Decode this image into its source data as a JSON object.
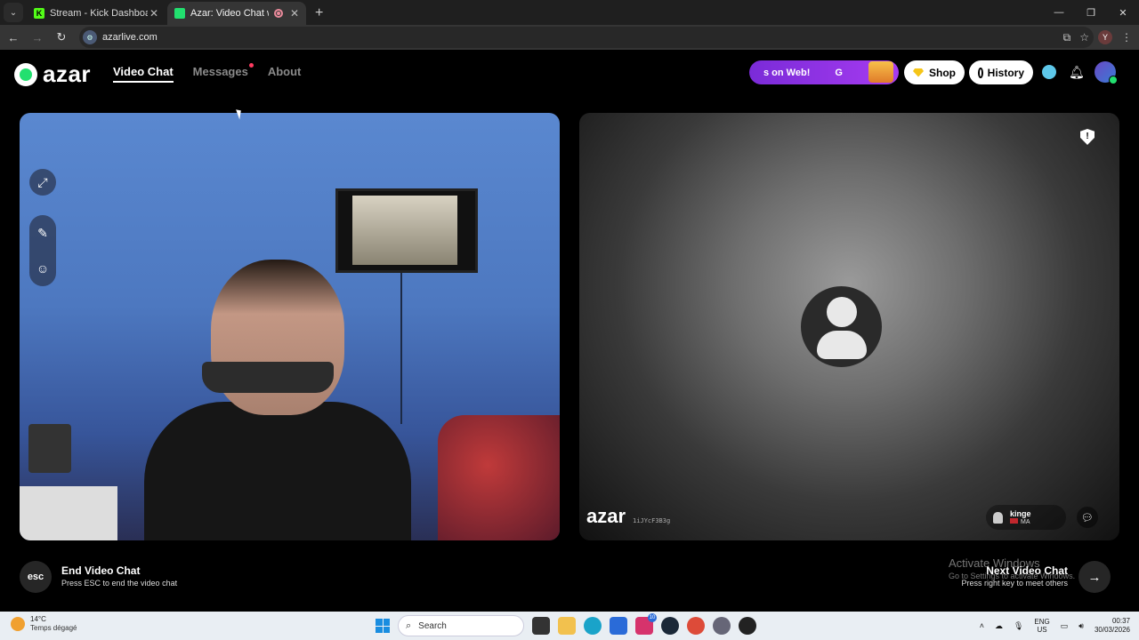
{
  "browser": {
    "tabs": [
      {
        "title": "Stream - Kick Dashboard",
        "favicon": "kick-icon",
        "color": "#53fc18",
        "active": false
      },
      {
        "title": "Azar: Video Chat with New",
        "favicon": "azar-icon",
        "color": "#22e06f",
        "active": true
      }
    ],
    "url": "azarlive.com",
    "profile_initial": "Y"
  },
  "nav": {
    "logo": "azar",
    "links": [
      {
        "label": "Video Chat",
        "active": true
      },
      {
        "label": "Messages",
        "active": false,
        "has_notification": true
      },
      {
        "label": "About",
        "active": false
      }
    ],
    "promo": {
      "text": "s on Web!",
      "go": "G"
    },
    "shop_label": "Shop",
    "history_label": "History"
  },
  "partner": {
    "watermark": "azar",
    "id_text": "1iJYcF3B3g",
    "name": "kinge",
    "country": "MA"
  },
  "controls": {
    "esc_key": "esc",
    "end_title": "End Video Chat",
    "end_sub": "Press ESC to end the video chat",
    "next_title": "Next Video Chat",
    "next_sub": "Press right key to meet others"
  },
  "windows_notice": {
    "title": "Activate Windows",
    "sub": "Go to Settings to activate Windows."
  },
  "taskbar": {
    "weather_temp": "14°C",
    "weather_desc": "Temps dégagé",
    "search_placeholder": "Search",
    "instagram_badge": "10",
    "lang_top": "ENG",
    "lang_bottom": "US",
    "time": "00:37",
    "date": "30/03/2026"
  },
  "colors": {
    "accent_green": "#22e06f",
    "promo_purple": "#7a2bd8",
    "notification_red": "#ff3b61"
  }
}
